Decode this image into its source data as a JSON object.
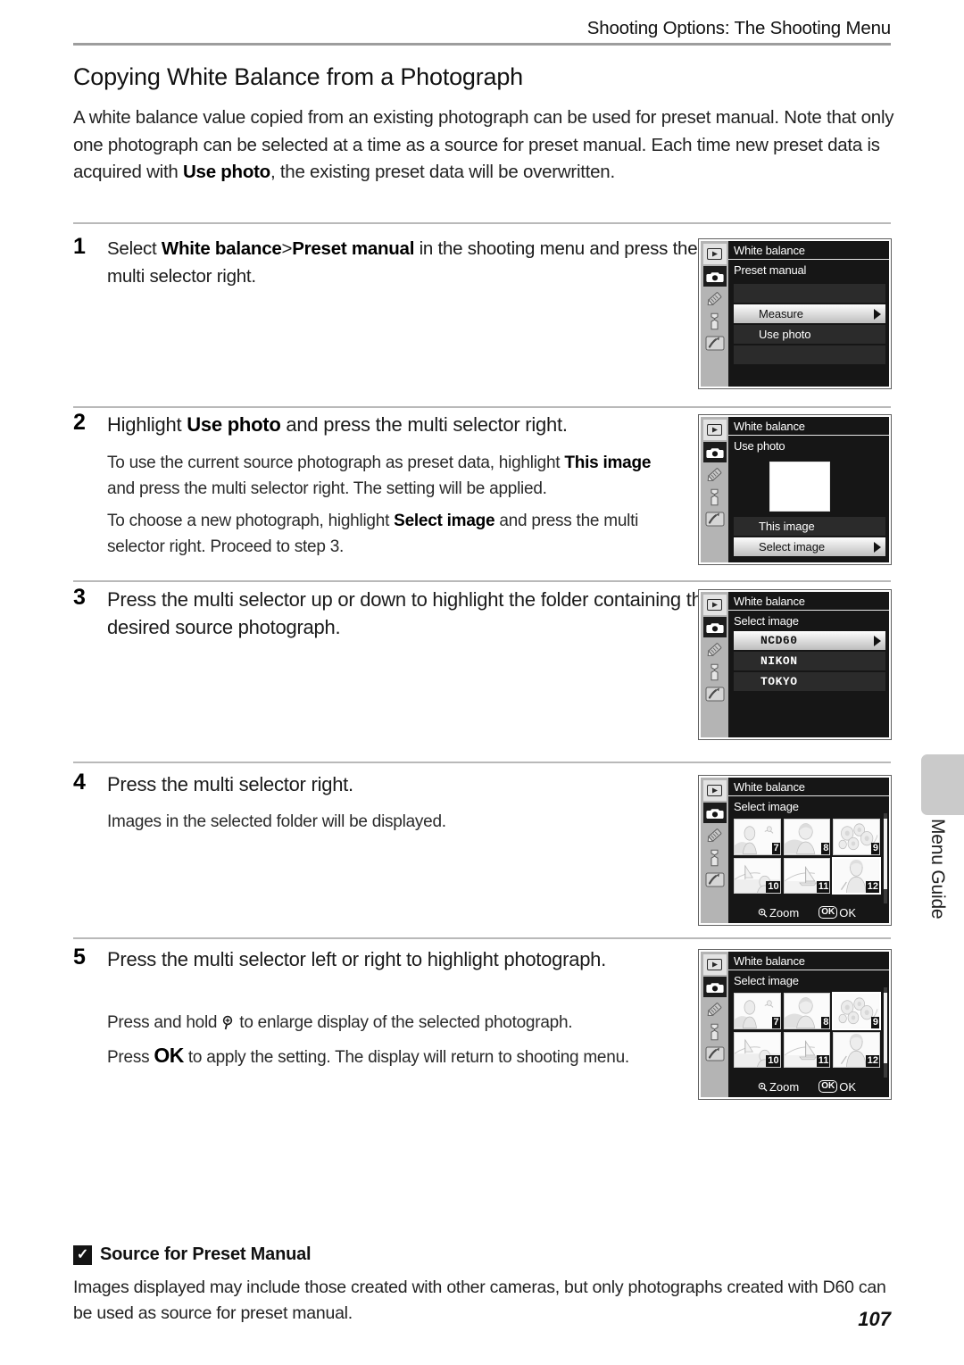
{
  "header": {
    "running_title": "Shooting Options: The Shooting Menu"
  },
  "section": {
    "title": "Copying White Balance from a Photograph"
  },
  "intro": {
    "line1": "A white balance value copied from an existing photograph can be used for preset manual.",
    "line2": "Note that only one photograph can be selected at a time as a source for preset manual.",
    "line3_a": "Each time new preset data is acquired with ",
    "line3_b": "Use photo",
    "line3_c": ", the existing preset data will be",
    "line4": "overwritten."
  },
  "steps": [
    {
      "number": "1",
      "head_a": "Select ",
      "head_b": "White balance",
      "head_c": ">",
      "head_d": "Preset manual",
      "head_e": " in the shooting menu",
      "head_f": "and press the multi selector right.",
      "body": []
    },
    {
      "number": "2",
      "head_a": "Highlight ",
      "head_b": "Use photo",
      "head_c": " and press the multi selector right.",
      "body": [
        "To use the current source photograph as preset data, highlight This image and press the multi selector right. The setting will be applied.",
        "To choose a new photograph, highlight Select image and press the multi selector right. Proceed to step 3."
      ]
    },
    {
      "number": "3",
      "head_a": "Press the multi selector up or down to highlight the",
      "head_b": "folder containing the desired source photograph.",
      "body": []
    },
    {
      "number": "4",
      "head_a": "Press the multi selector right.",
      "body": [
        "Images in the selected folder will be displayed."
      ]
    },
    {
      "number": "5",
      "head_a": "Press the multi selector left or right to highlight",
      "head_b": "photograph.",
      "body": [
        "Press and hold Q to enlarge display of the selected photograph.",
        "Press OK to apply the setting. The display will return to shooting menu."
      ]
    }
  ],
  "step2_body": {
    "p1_a": "To use the current source photograph as preset data, highlight ",
    "p1_b": "This",
    "p1_c": "image",
    "p1_d": " and press the multi selector right. The setting will be applied.",
    "p2_a": "To choose a new photograph, highlight ",
    "p2_b": "Select image",
    "p2_c": " and press the",
    "p2_d": "multi selector right. Proceed to step 3."
  },
  "step5_body": {
    "p1_a": "Press and hold ",
    "p1_icon": "zoom-in-magnifier",
    "p1_b": " to enlarge display of the selected photograph.",
    "p2_a": "Press ",
    "p2_ok": "OK",
    "p2_b": " to apply the setting. The display will return to shooting",
    "p2_c": "menu."
  },
  "lcd_screens": [
    {
      "id": "screen-1",
      "title": "White balance",
      "subtitle": "Preset manual",
      "rail_icons": [
        "playback-icon",
        "camera-icon",
        "pencil-icon",
        "wrench-icon",
        "retouch-icon"
      ],
      "rail_active_index": 1,
      "rows": [
        {
          "label": "",
          "selected": false,
          "caret": false
        },
        {
          "label": "Measure",
          "selected": true,
          "caret": true
        },
        {
          "label": "Use photo",
          "selected": false,
          "caret": false
        },
        {
          "label": "",
          "selected": false,
          "caret": false
        }
      ]
    },
    {
      "id": "screen-2",
      "title": "White balance",
      "subtitle": "Use photo",
      "preview": true,
      "rows": [
        {
          "label": "This image",
          "selected": false,
          "caret": false
        },
        {
          "label": "Select image",
          "selected": true,
          "caret": true
        }
      ]
    },
    {
      "id": "screen-3",
      "title": "White balance",
      "subtitle": "Select image",
      "folders": [
        {
          "label": "NCD60",
          "selected": true,
          "caret": true
        },
        {
          "label": "NIKON",
          "selected": false,
          "caret": false
        },
        {
          "label": "TOKYO",
          "selected": false,
          "caret": false
        }
      ]
    },
    {
      "id": "screen-4",
      "title": "White balance",
      "subtitle": "Select image",
      "thumbnails": [
        {
          "num": "7",
          "art": "portrait-woman",
          "selected": false
        },
        {
          "num": "8",
          "art": "portrait-child",
          "selected": false
        },
        {
          "num": "9",
          "art": "flowers",
          "selected": false
        },
        {
          "num": "10",
          "art": "boat-person",
          "selected": false
        },
        {
          "num": "11",
          "art": "boat-landscape",
          "selected": false
        },
        {
          "num": "12",
          "art": "standing-woman",
          "selected": true
        }
      ],
      "footer": {
        "zoom": "Zoom",
        "ok_badge": "OK",
        "ok": "OK"
      }
    },
    {
      "id": "screen-5",
      "title": "White balance",
      "subtitle": "Select image",
      "thumbnails": [
        {
          "num": "7",
          "art": "portrait-woman",
          "selected": false
        },
        {
          "num": "8",
          "art": "portrait-child",
          "selected": false
        },
        {
          "num": "9",
          "art": "flowers",
          "selected": true
        },
        {
          "num": "10",
          "art": "boat-person",
          "selected": false
        },
        {
          "num": "11",
          "art": "boat-landscape",
          "selected": false
        },
        {
          "num": "12",
          "art": "standing-woman",
          "selected": false
        }
      ],
      "footer": {
        "zoom": "Zoom",
        "ok_badge": "OK",
        "ok": "OK"
      }
    }
  ],
  "side_tab": {
    "label": "Menu Guide"
  },
  "note": {
    "icon": "caution-checkmark-icon",
    "title": "Source for Preset Manual",
    "line1": "Images displayed may include those created with other cameras, but only photographs created",
    "line2": "with D60 can be used as source for preset manual."
  },
  "page_number": "107"
}
